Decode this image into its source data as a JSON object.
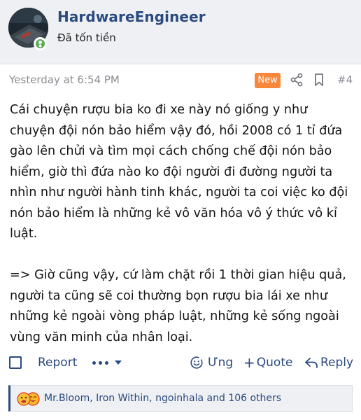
{
  "user": {
    "name": "HardwareEngineer",
    "title": "Đã tốn tiền"
  },
  "post": {
    "timestamp": "Yesterday at 6:54 PM",
    "badge": "New",
    "number": "#4",
    "paragraphs": [
      "Cái chuyện rượu bia ko đi xe này nó giống y như chuyện đội nón bảo hiểm vậy đó, hồi 2008 có 1 tỉ đứa gào lên chửi và tìm mọi cách chống chế đội nón bảo hiểm, giờ thì đứa nào ko đội người đi đường người ta nhìn như người hành tinh khác, người ta coi việc ko đội nón bảo hiểm là những kẻ vô văn hóa vô ý thức vô kỉ luật.",
      "=> Giờ cũng vậy, cứ làm chặt rồi 1 thời gian hiệu quả, người ta cũng sẽ coi thường bọn rượu bia lái xe như những kẻ ngoài vòng pháp luật, những kẻ sống ngoài vùng văn minh của nhân loại."
    ]
  },
  "actions": {
    "report": "Report",
    "react": "Ưng",
    "quote": "Quote",
    "reply": "Reply"
  },
  "reactions": {
    "text": "Mr.Bloom, Iron Within, ngoinhala and 106 others"
  },
  "colors": {
    "accent": "#2b4a7e",
    "badge": "#f7873b",
    "header_bg": "#eef0f3",
    "online": "#5aaa55"
  }
}
